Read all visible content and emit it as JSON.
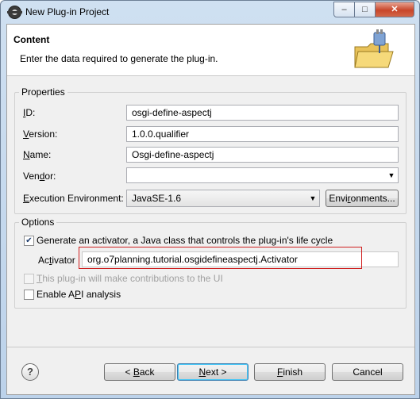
{
  "window": {
    "title": "New Plug-in Project",
    "minimize_glyph": "–",
    "maximize_glyph": "□",
    "close_glyph": "✕"
  },
  "header": {
    "title": "Content",
    "description": "Enter the data required to generate the plug-in."
  },
  "properties": {
    "group_label": "Properties",
    "id": {
      "label_mnemonic": "I",
      "label_rest": "D:",
      "value": "osgi-define-aspectj"
    },
    "version": {
      "label_mnemonic": "V",
      "label_rest": "ersion:",
      "value": "1.0.0.qualifier"
    },
    "name": {
      "label_mnemonic": "N",
      "label_rest": "ame:",
      "value": "Osgi-define-aspectj"
    },
    "vendor": {
      "label_pre": "Ven",
      "label_mnemonic": "d",
      "label_rest": "or:",
      "value": ""
    },
    "execution_env": {
      "label_mnemonic": "E",
      "label_rest": "xecution Environment:",
      "value": "JavaSE-1.6",
      "environments_button": {
        "pre": "Envi",
        "mnemonic": "r",
        "rest": "onments..."
      }
    }
  },
  "options": {
    "group_label": "Options",
    "generate_activator": {
      "label": "Generate an activator, a Java class that controls the plug-in's life cycle",
      "checked": true
    },
    "activator": {
      "label_pre": "Ac",
      "label_mnemonic": "t",
      "label_rest": "ivator",
      "value": "org.o7planning.tutorial.osgidefineaspectj.Activator"
    },
    "ui_contributions": {
      "label_mnemonic": "T",
      "label_rest": "his plug-in will make contributions to the UI",
      "checked": false,
      "enabled": false
    },
    "api_analysis": {
      "label_pre": "Enable A",
      "label_mnemonic": "P",
      "label_rest": "I analysis",
      "checked": false
    }
  },
  "footer": {
    "help_glyph": "?",
    "back": {
      "pre": "< ",
      "mnemonic": "B",
      "rest": "ack"
    },
    "next": {
      "mnemonic": "N",
      "rest": "ext >"
    },
    "finish": {
      "mnemonic": "F",
      "rest": "inish"
    },
    "cancel": "Cancel"
  },
  "icons": {
    "app": "eclipse-icon",
    "wizard": "plugin-folder-icon",
    "combo": "dropdown-arrow-icon",
    "check": "checkmark-icon"
  },
  "colors": {
    "highlight": "#d02020",
    "default_button_border": "#3c7fb1"
  }
}
